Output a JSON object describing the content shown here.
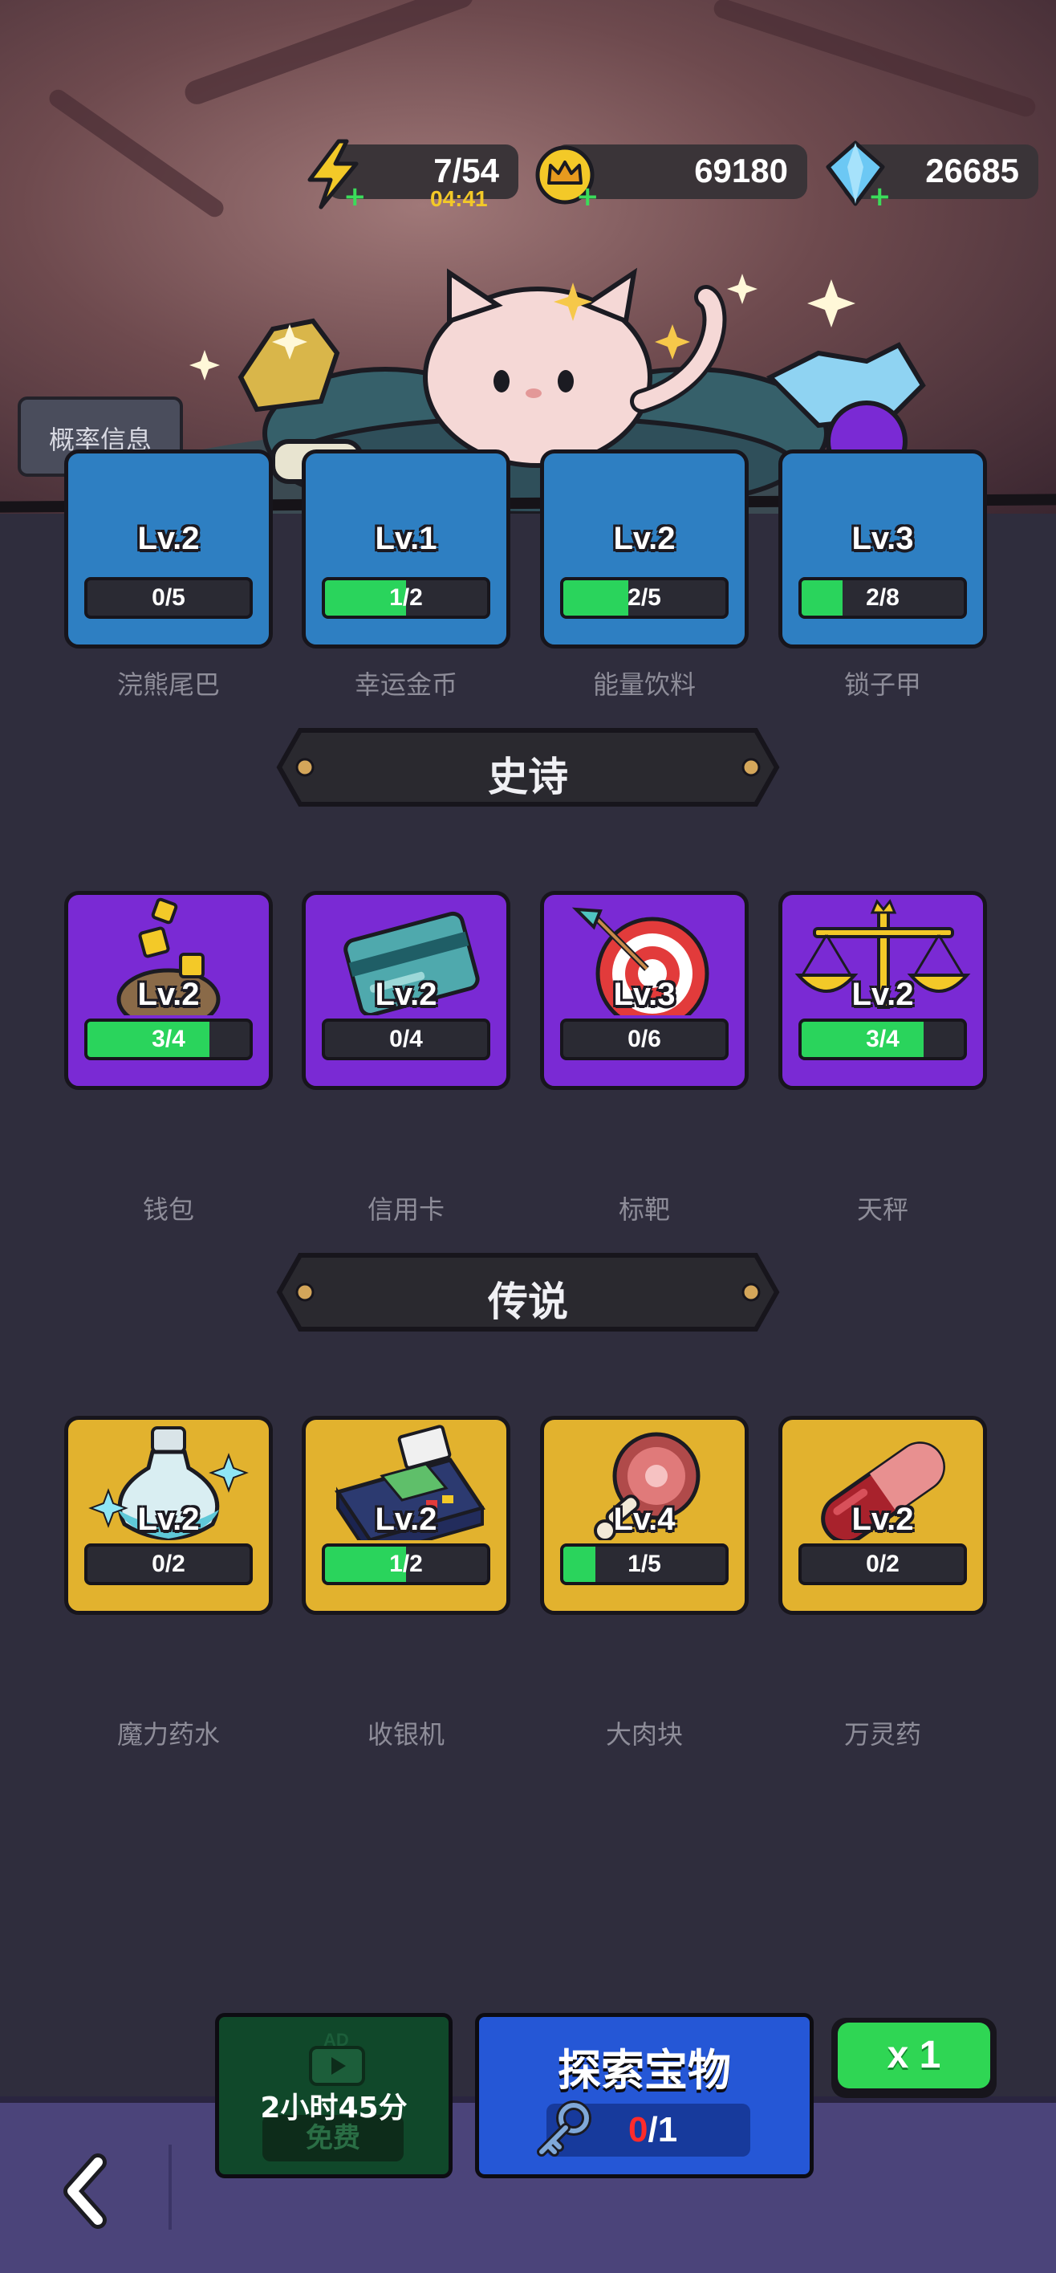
{
  "resources": {
    "energy": {
      "value": "7/54",
      "timer": "04:41"
    },
    "coins": {
      "value": "69180"
    },
    "gems": {
      "value": "26685"
    }
  },
  "probability_button": "概率信息",
  "rare_row": [
    {
      "name": "浣熊尾巴",
      "level": "Lv.2",
      "progress": "0/5",
      "fill": 0
    },
    {
      "name": "幸运金币",
      "level": "Lv.1",
      "progress": "1/2",
      "fill": 0.5
    },
    {
      "name": "能量饮料",
      "level": "Lv.2",
      "progress": "2/5",
      "fill": 0.4
    },
    {
      "name": "锁子甲",
      "level": "Lv.3",
      "progress": "2/8",
      "fill": 0.25
    }
  ],
  "sections": {
    "epic": "史诗",
    "legendary": "传说"
  },
  "epic_row": [
    {
      "name": "钱包",
      "level": "Lv.2",
      "progress": "3/4",
      "fill": 0.75
    },
    {
      "name": "信用卡",
      "level": "Lv.2",
      "progress": "0/4",
      "fill": 0
    },
    {
      "name": "标靶",
      "level": "Lv.3",
      "progress": "0/6",
      "fill": 0
    },
    {
      "name": "天秤",
      "level": "Lv.2",
      "progress": "3/4",
      "fill": 0.75
    }
  ],
  "legendary_row": [
    {
      "name": "魔力药水",
      "level": "Lv.2",
      "progress": "0/2",
      "fill": 0
    },
    {
      "name": "收银机",
      "level": "Lv.2",
      "progress": "1/2",
      "fill": 0.5
    },
    {
      "name": "大肉块",
      "level": "Lv.4",
      "progress": "1/5",
      "fill": 0.2
    },
    {
      "name": "万灵药",
      "level": "Lv.2",
      "progress": "0/2",
      "fill": 0
    }
  ],
  "bottom": {
    "ad_badge": "AD",
    "ad_timer": "2小时45分",
    "ad_free": "免费",
    "explore_title": "探索宝物",
    "key_current": "0",
    "key_total": "/1",
    "multiplier": "x 1"
  },
  "colors": {
    "rare": "#2e7fc2",
    "epic": "#7a2ad4",
    "legendary": "#e2b22e",
    "progress_fill": "#2ad45c"
  }
}
